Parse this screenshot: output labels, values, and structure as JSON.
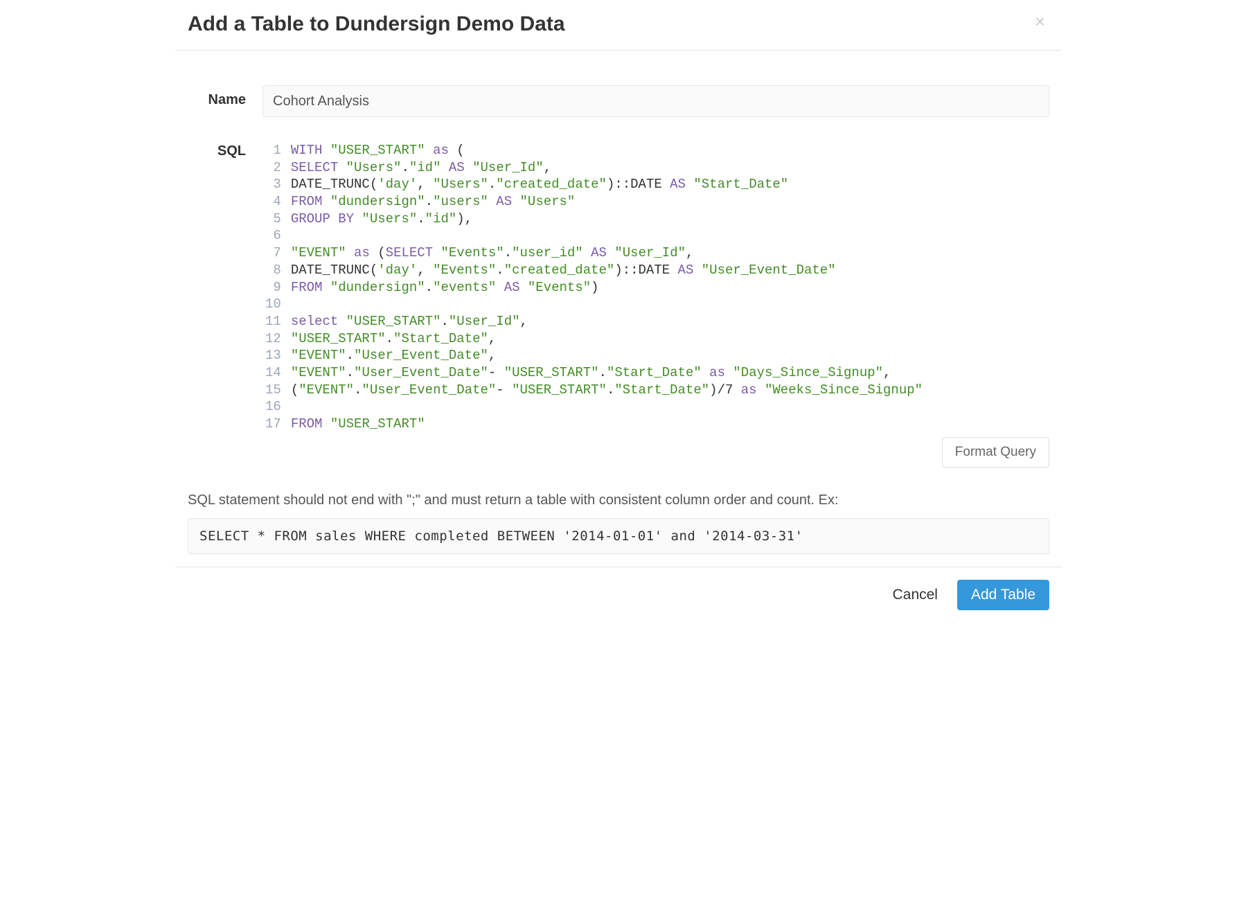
{
  "header": {
    "title": "Add a Table to Dundersign Demo Data"
  },
  "form": {
    "name_label": "Name",
    "name_value": "Cohort Analysis",
    "sql_label": "SQL",
    "format_button": "Format Query",
    "hint": "SQL statement should not end with \";\" and must return a table with consistent column order and count. Ex:",
    "example": "SELECT * FROM sales WHERE completed BETWEEN '2014-01-01' and '2014-03-31'"
  },
  "footer": {
    "cancel": "Cancel",
    "submit": "Add Table"
  },
  "sql_lines": [
    [
      {
        "t": "WITH",
        "c": "kw"
      },
      {
        "t": " ",
        "c": "plain"
      },
      {
        "t": "\"USER_START\"",
        "c": "str"
      },
      {
        "t": " ",
        "c": "plain"
      },
      {
        "t": "as",
        "c": "kw"
      },
      {
        "t": " (",
        "c": "plain"
      }
    ],
    [
      {
        "t": "SELECT",
        "c": "kw"
      },
      {
        "t": " ",
        "c": "plain"
      },
      {
        "t": "\"Users\"",
        "c": "str"
      },
      {
        "t": ".",
        "c": "plain"
      },
      {
        "t": "\"id\"",
        "c": "str"
      },
      {
        "t": " ",
        "c": "plain"
      },
      {
        "t": "AS",
        "c": "kw"
      },
      {
        "t": " ",
        "c": "plain"
      },
      {
        "t": "\"User_Id\"",
        "c": "str"
      },
      {
        "t": ",",
        "c": "plain"
      }
    ],
    [
      {
        "t": "DATE_TRUNC(",
        "c": "plain"
      },
      {
        "t": "'day'",
        "c": "str"
      },
      {
        "t": ", ",
        "c": "plain"
      },
      {
        "t": "\"Users\"",
        "c": "str"
      },
      {
        "t": ".",
        "c": "plain"
      },
      {
        "t": "\"created_date\"",
        "c": "str"
      },
      {
        "t": ")::DATE ",
        "c": "plain"
      },
      {
        "t": "AS",
        "c": "kw"
      },
      {
        "t": " ",
        "c": "plain"
      },
      {
        "t": "\"Start_Date\"",
        "c": "str"
      }
    ],
    [
      {
        "t": "FROM",
        "c": "kw"
      },
      {
        "t": " ",
        "c": "plain"
      },
      {
        "t": "\"dundersign\"",
        "c": "str"
      },
      {
        "t": ".",
        "c": "plain"
      },
      {
        "t": "\"users\"",
        "c": "str"
      },
      {
        "t": " ",
        "c": "plain"
      },
      {
        "t": "AS",
        "c": "kw"
      },
      {
        "t": " ",
        "c": "plain"
      },
      {
        "t": "\"Users\"",
        "c": "str"
      }
    ],
    [
      {
        "t": "GROUP BY",
        "c": "kw"
      },
      {
        "t": " ",
        "c": "plain"
      },
      {
        "t": "\"Users\"",
        "c": "str"
      },
      {
        "t": ".",
        "c": "plain"
      },
      {
        "t": "\"id\"",
        "c": "str"
      },
      {
        "t": "),",
        "c": "plain"
      }
    ],
    [],
    [
      {
        "t": "\"EVENT\"",
        "c": "str"
      },
      {
        "t": " ",
        "c": "plain"
      },
      {
        "t": "as",
        "c": "kw"
      },
      {
        "t": " (",
        "c": "plain"
      },
      {
        "t": "SELECT",
        "c": "kw"
      },
      {
        "t": " ",
        "c": "plain"
      },
      {
        "t": "\"Events\"",
        "c": "str"
      },
      {
        "t": ".",
        "c": "plain"
      },
      {
        "t": "\"user_id\"",
        "c": "str"
      },
      {
        "t": " ",
        "c": "plain"
      },
      {
        "t": "AS",
        "c": "kw"
      },
      {
        "t": " ",
        "c": "plain"
      },
      {
        "t": "\"User_Id\"",
        "c": "str"
      },
      {
        "t": ",",
        "c": "plain"
      }
    ],
    [
      {
        "t": "DATE_TRUNC(",
        "c": "plain"
      },
      {
        "t": "'day'",
        "c": "str"
      },
      {
        "t": ", ",
        "c": "plain"
      },
      {
        "t": "\"Events\"",
        "c": "str"
      },
      {
        "t": ".",
        "c": "plain"
      },
      {
        "t": "\"created_date\"",
        "c": "str"
      },
      {
        "t": ")::DATE ",
        "c": "plain"
      },
      {
        "t": "AS",
        "c": "kw"
      },
      {
        "t": " ",
        "c": "plain"
      },
      {
        "t": "\"User_Event_Date\"",
        "c": "str"
      }
    ],
    [
      {
        "t": "FROM",
        "c": "kw"
      },
      {
        "t": " ",
        "c": "plain"
      },
      {
        "t": "\"dundersign\"",
        "c": "str"
      },
      {
        "t": ".",
        "c": "plain"
      },
      {
        "t": "\"events\"",
        "c": "str"
      },
      {
        "t": " ",
        "c": "plain"
      },
      {
        "t": "AS",
        "c": "kw"
      },
      {
        "t": " ",
        "c": "plain"
      },
      {
        "t": "\"Events\"",
        "c": "str"
      },
      {
        "t": ")",
        "c": "plain"
      }
    ],
    [],
    [
      {
        "t": "select",
        "c": "kw"
      },
      {
        "t": " ",
        "c": "plain"
      },
      {
        "t": "\"USER_START\"",
        "c": "str"
      },
      {
        "t": ".",
        "c": "plain"
      },
      {
        "t": "\"User_Id\"",
        "c": "str"
      },
      {
        "t": ",",
        "c": "plain"
      }
    ],
    [
      {
        "t": "\"USER_START\"",
        "c": "str"
      },
      {
        "t": ".",
        "c": "plain"
      },
      {
        "t": "\"Start_Date\"",
        "c": "str"
      },
      {
        "t": ",",
        "c": "plain"
      }
    ],
    [
      {
        "t": "\"EVENT\"",
        "c": "str"
      },
      {
        "t": ".",
        "c": "plain"
      },
      {
        "t": "\"User_Event_Date\"",
        "c": "str"
      },
      {
        "t": ",",
        "c": "plain"
      }
    ],
    [
      {
        "t": "\"EVENT\"",
        "c": "str"
      },
      {
        "t": ".",
        "c": "plain"
      },
      {
        "t": "\"User_Event_Date\"",
        "c": "str"
      },
      {
        "t": "- ",
        "c": "plain"
      },
      {
        "t": "\"USER_START\"",
        "c": "str"
      },
      {
        "t": ".",
        "c": "plain"
      },
      {
        "t": "\"Start_Date\"",
        "c": "str"
      },
      {
        "t": " ",
        "c": "plain"
      },
      {
        "t": "as",
        "c": "kw"
      },
      {
        "t": " ",
        "c": "plain"
      },
      {
        "t": "\"Days_Since_Signup\"",
        "c": "str"
      },
      {
        "t": ",",
        "c": "plain"
      }
    ],
    [
      {
        "t": "(",
        "c": "plain"
      },
      {
        "t": "\"EVENT\"",
        "c": "str"
      },
      {
        "t": ".",
        "c": "plain"
      },
      {
        "t": "\"User_Event_Date\"",
        "c": "str"
      },
      {
        "t": "- ",
        "c": "plain"
      },
      {
        "t": "\"USER_START\"",
        "c": "str"
      },
      {
        "t": ".",
        "c": "plain"
      },
      {
        "t": "\"Start_Date\"",
        "c": "str"
      },
      {
        "t": ")/7 ",
        "c": "plain"
      },
      {
        "t": "as",
        "c": "kw"
      },
      {
        "t": " ",
        "c": "plain"
      },
      {
        "t": "\"Weeks_Since_Signup\"",
        "c": "str"
      }
    ],
    [],
    [
      {
        "t": "FROM",
        "c": "kw"
      },
      {
        "t": " ",
        "c": "plain"
      },
      {
        "t": "\"USER_START\"",
        "c": "str"
      }
    ]
  ]
}
